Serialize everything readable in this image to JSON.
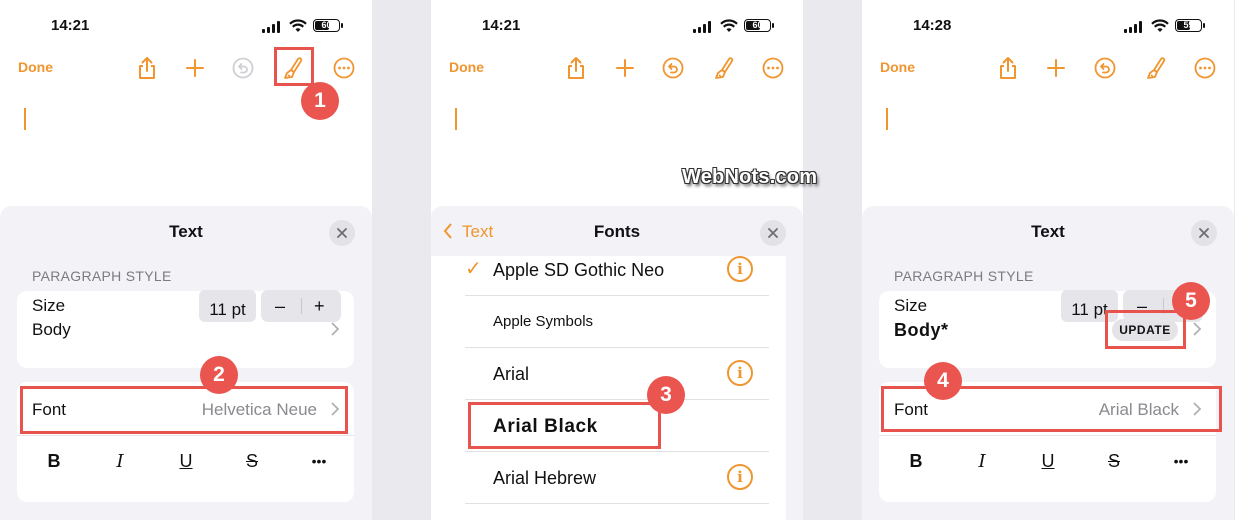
{
  "phones": [
    {
      "status": {
        "time": "14:21",
        "battery": "60"
      },
      "toolbar": {
        "done": "Done"
      },
      "sheet": {
        "title": "Text",
        "section": "PARAGRAPH STYLE",
        "style_row": "Body",
        "font_label": "Font",
        "font_value": "Helvetica Neue",
        "format": {
          "bold": "B",
          "italic": "I",
          "underline": "U",
          "strike": "S",
          "more": "•••"
        },
        "size_label": "Size",
        "size_value": "11 pt",
        "minus": "–",
        "plus": "+"
      },
      "callouts": [
        "1",
        "2"
      ]
    },
    {
      "status": {
        "time": "14:21",
        "battery": "60"
      },
      "toolbar": {
        "done": "Done"
      },
      "fonts": {
        "back": "Text",
        "title": "Fonts",
        "items": [
          {
            "name": "Apple SD Gothic Neo",
            "checked": true,
            "info": true
          },
          {
            "name": "Apple  Symbols",
            "checked": false,
            "info": false
          },
          {
            "name": "Arial",
            "checked": false,
            "info": true
          },
          {
            "name": "Arial Black",
            "checked": false,
            "info": false
          },
          {
            "name": "Arial Hebrew",
            "checked": false,
            "info": true
          }
        ]
      },
      "callouts": [
        "3"
      ],
      "watermark": "WebNots.com"
    },
    {
      "status": {
        "time": "14:28",
        "battery": "59"
      },
      "toolbar": {
        "done": "Done"
      },
      "sheet": {
        "title": "Text",
        "section": "PARAGRAPH STYLE",
        "style_row": "Body*",
        "update": "UPDATE",
        "font_label": "Font",
        "font_value": "Arial Black",
        "format": {
          "bold": "B",
          "italic": "I",
          "underline": "U",
          "strike": "S",
          "more": "•••"
        },
        "size_label": "Size",
        "size_value": "11 pt",
        "minus": "–",
        "plus": "+"
      },
      "callouts": [
        "4",
        "5"
      ]
    }
  ],
  "colors": {
    "accent": "#f0952f",
    "callout": "#ea5550",
    "highlight": "#e6544d"
  }
}
